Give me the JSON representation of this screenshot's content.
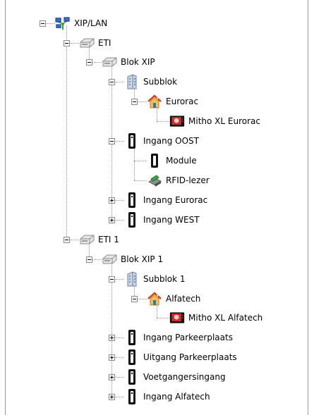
{
  "tree": {
    "nodes": [
      {
        "label": "XIP/LAN",
        "icon": "network-icon",
        "expanded": true
      },
      {
        "label": "ETI",
        "icon": "device-icon",
        "expanded": true
      },
      {
        "label": "Blok XIP",
        "icon": "device-icon",
        "expanded": true
      },
      {
        "label": "Subblok",
        "icon": "building-icon",
        "expanded": true
      },
      {
        "label": "Eurorac",
        "icon": "house-icon",
        "expanded": true
      },
      {
        "label": "Mitho XL Eurorac",
        "icon": "video-monitor-icon"
      },
      {
        "label": "Ingang OOST",
        "icon": "door-panel-icon",
        "expanded": true
      },
      {
        "label": "Module",
        "icon": "module-icon"
      },
      {
        "label": "RFID-lezer",
        "icon": "rfid-reader-icon"
      },
      {
        "label": "Ingang Eurorac",
        "icon": "door-panel-icon",
        "expanded": false
      },
      {
        "label": "Ingang WEST",
        "icon": "door-panel-icon",
        "expanded": false
      },
      {
        "label": "ETI 1",
        "icon": "device-icon",
        "expanded": true
      },
      {
        "label": "Blok XIP 1",
        "icon": "device-icon",
        "expanded": true
      },
      {
        "label": "Subblok 1",
        "icon": "building-icon",
        "expanded": true
      },
      {
        "label": "Alfatech",
        "icon": "house-icon",
        "expanded": true
      },
      {
        "label": "Mitho XL Alfatech",
        "icon": "video-monitor-icon"
      },
      {
        "label": "Ingang Parkeerplaats",
        "icon": "door-panel-icon",
        "expanded": false
      },
      {
        "label": "Uitgang Parkeerplaats",
        "icon": "door-panel-icon",
        "expanded": false
      },
      {
        "label": "Voetgangersingang",
        "icon": "door-panel-icon",
        "expanded": false
      },
      {
        "label": "Ingang Alfatech",
        "icon": "door-panel-icon",
        "expanded": false
      }
    ]
  }
}
